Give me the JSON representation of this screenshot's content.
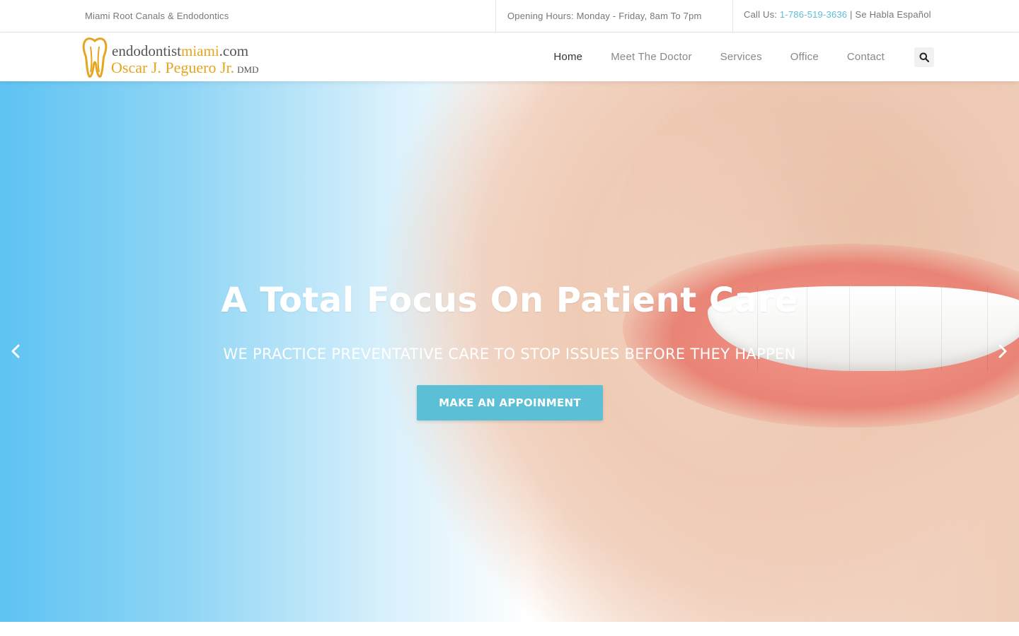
{
  "topbar": {
    "tagline": "Miami Root Canals & Endodontics",
    "hours": "Opening Hours: Monday - Friday, 8am To 7pm",
    "call_prefix": "Call Us: ",
    "phone": "1-786-519-3636",
    "call_suffix": " | Se Habla Español"
  },
  "logo": {
    "domain_part1": "endodontist",
    "domain_accent": "miami",
    "domain_part2": ".com",
    "name": "Oscar J. Peguero Jr.",
    "credential": "DMD"
  },
  "nav": {
    "items": [
      "Home",
      "Meet The Doctor",
      "Services",
      "Office",
      "Contact"
    ],
    "active": "Home"
  },
  "hero": {
    "title": "A Total Focus On Patient Care",
    "subtitle": "WE PRACTICE PREVENTATIVE CARE TO STOP ISSUES BEFORE THEY HAPPEN",
    "cta_label": "MAKE AN APPOINMENT"
  },
  "icons": {
    "search": "search-icon",
    "prev": "chevron-left-icon",
    "next": "chevron-right-icon",
    "logo": "tooth-icon"
  },
  "colors": {
    "accent": "#5bbfd6",
    "logo_gold": "#e7a51f"
  }
}
